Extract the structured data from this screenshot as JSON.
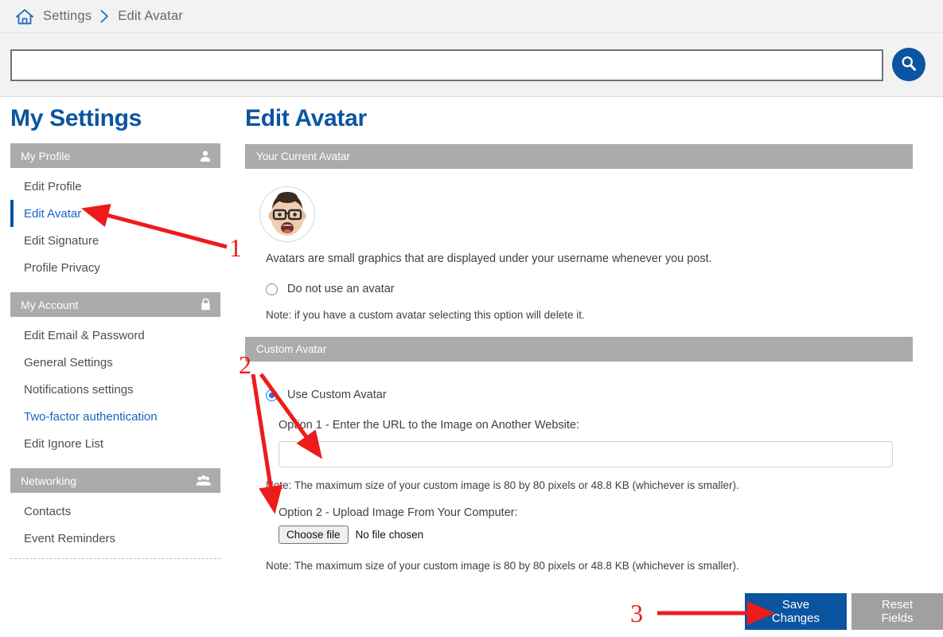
{
  "breadcrumb": {
    "home_icon": "home-icon",
    "items": [
      "Settings",
      "Edit Avatar"
    ],
    "separator": "›"
  },
  "search": {
    "value": "",
    "placeholder": "",
    "button_icon": "search-icon"
  },
  "sidebar": {
    "title": "My Settings",
    "sections": [
      {
        "label": "My Profile",
        "icon": "user-icon",
        "items": [
          {
            "label": "Edit Profile",
            "state": "normal"
          },
          {
            "label": "Edit Avatar",
            "state": "active"
          },
          {
            "label": "Edit Signature",
            "state": "normal"
          },
          {
            "label": "Profile Privacy",
            "state": "normal"
          }
        ]
      },
      {
        "label": "My Account",
        "icon": "lock-icon",
        "items": [
          {
            "label": "Edit Email & Password",
            "state": "normal"
          },
          {
            "label": "General Settings",
            "state": "normal"
          },
          {
            "label": "Notifications settings",
            "state": "normal"
          },
          {
            "label": "Two-factor authentication",
            "state": "link"
          },
          {
            "label": "Edit Ignore List",
            "state": "normal"
          }
        ]
      },
      {
        "label": "Networking",
        "icon": "group-icon",
        "items": [
          {
            "label": "Contacts",
            "state": "normal"
          },
          {
            "label": "Event Reminders",
            "state": "normal"
          }
        ]
      }
    ]
  },
  "main": {
    "title": "Edit Avatar",
    "current_avatar_panel": {
      "header": "Your Current Avatar",
      "avatar_icon": "avatar-face-icon",
      "description": "Avatars are small graphics that are displayed under your username whenever you post.",
      "no_avatar_radio": {
        "label": "Do not use an avatar",
        "selected": false
      },
      "no_avatar_note": "Note: if you have a custom avatar selecting this option will delete it."
    },
    "custom_avatar_panel": {
      "header": "Custom Avatar",
      "use_custom_radio": {
        "label": "Use Custom Avatar",
        "selected": true
      },
      "option1_label": "Option 1 - Enter the URL to the Image on Another Website:",
      "option1_value": "",
      "option1_placeholder": "",
      "option1_note": "Note: The maximum size of your custom image is 80 by 80 pixels or 48.8 KB (whichever is smaller).",
      "option2_label": "Option 2 - Upload Image From Your Computer:",
      "file_button_label": "Choose file",
      "file_status": "No file chosen",
      "option2_note": "Note: The maximum size of your custom image is 80 by 80 pixels or 48.8 KB (whichever is smaller)."
    },
    "actions": {
      "save_label": "Save Changes",
      "reset_label": "Reset Fields"
    }
  },
  "annotations": {
    "color": "#ee1b1b",
    "markers": [
      {
        "number": "1",
        "target": "sidebar-item-edit-avatar"
      },
      {
        "number": "2",
        "target": "custom-avatar-inputs"
      },
      {
        "number": "3",
        "target": "save-changes-button"
      }
    ]
  },
  "colors": {
    "brand_blue": "#0b54a0",
    "link_blue": "#1565c0",
    "panel_gray": "#ababab",
    "button_gray": "#a0a0a0",
    "annotation_red": "#ee1b1b"
  }
}
